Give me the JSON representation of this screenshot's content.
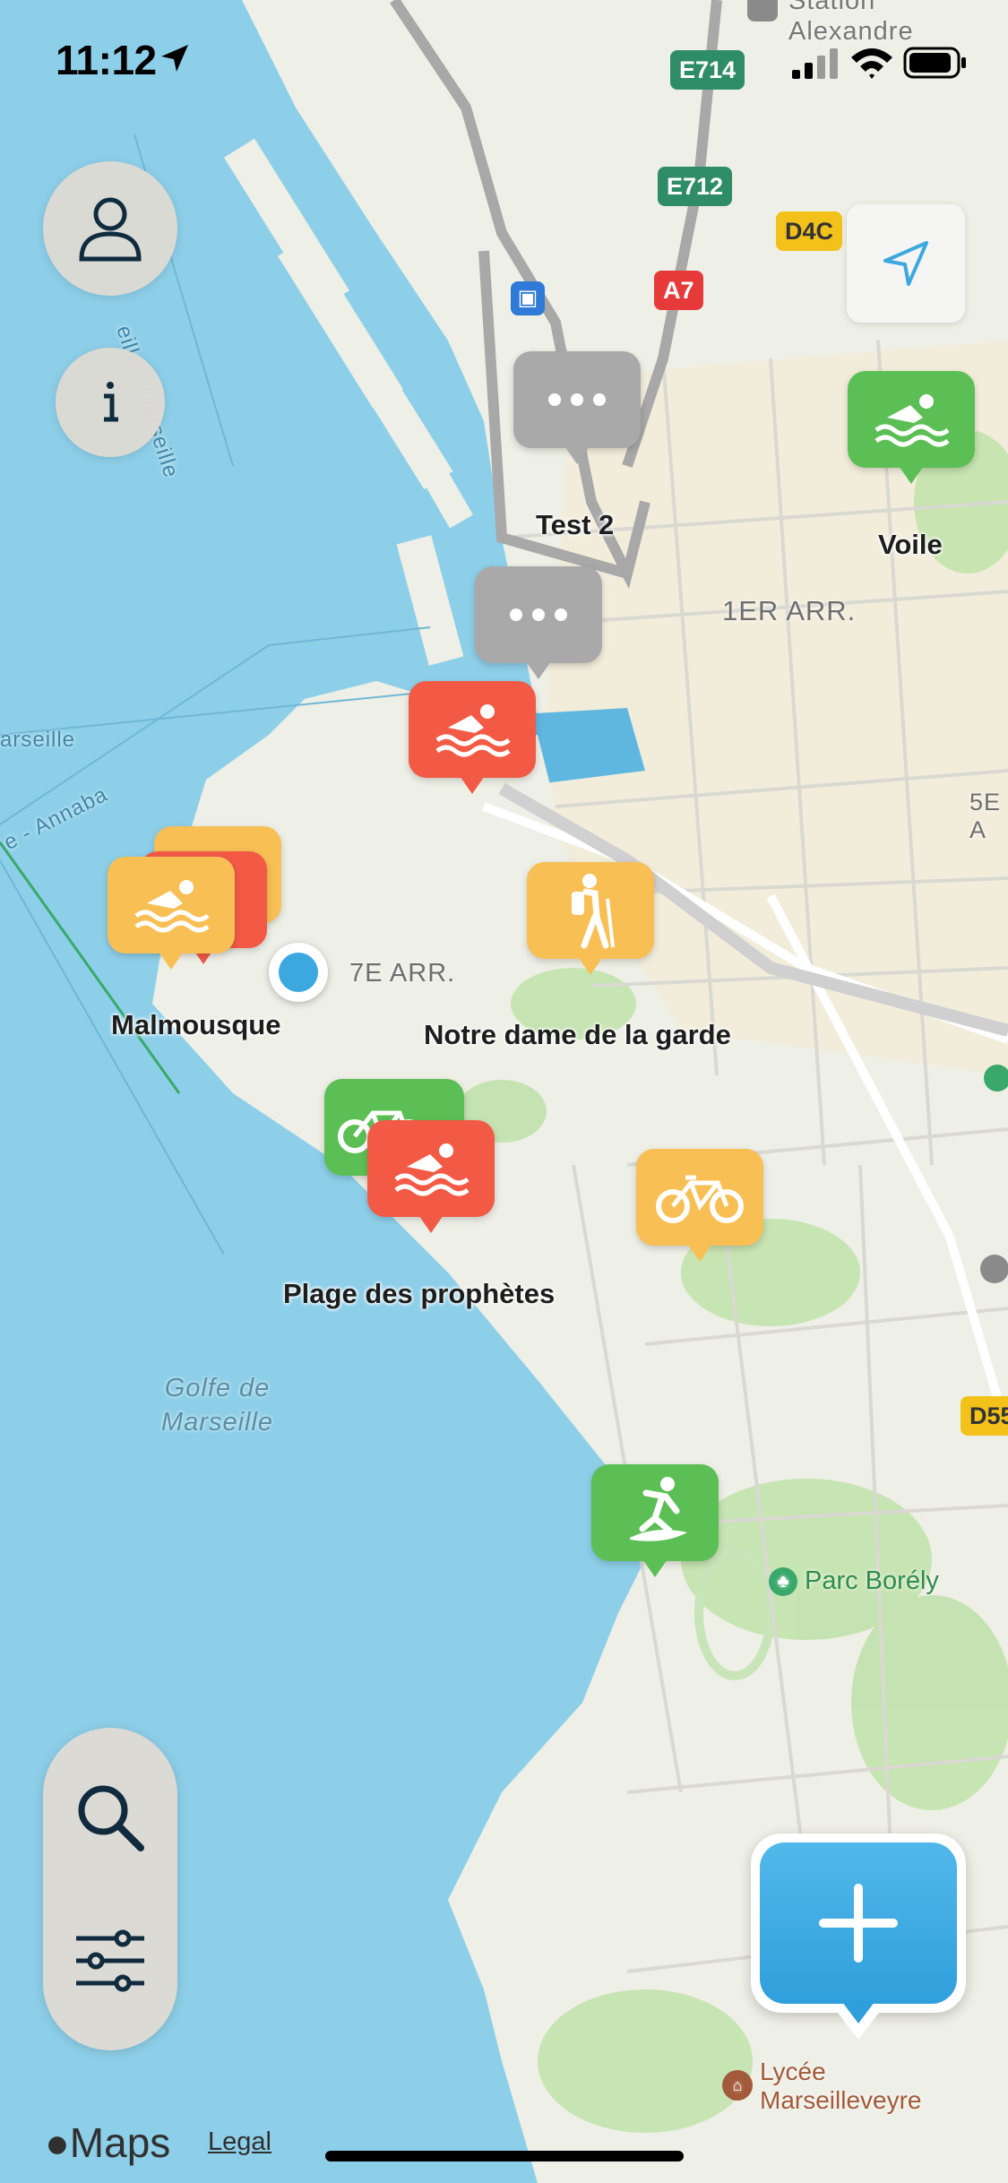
{
  "status_bar": {
    "time": "11:12"
  },
  "map": {
    "labels": {
      "district_1": "1ER ARR.",
      "district_7": "7E ARR.",
      "district_5": "5E A",
      "gulf": "Golfe de\nMarseille",
      "station": "Station\nAlexandre",
      "park": "Parc Borély",
      "lycee": "Lycée\nMarseilleveyre",
      "ferry_1": "eille - Marseille",
      "ferry_2": "arseille",
      "ferry_3": "e - Annaba"
    },
    "road_shields": [
      {
        "label": "E714",
        "color": "#2e8c67"
      },
      {
        "label": "E712",
        "color": "#2e8c67"
      },
      {
        "label": "A7",
        "color": "#e63a3a"
      },
      {
        "label": "D4C",
        "color": "#f2c21b"
      },
      {
        "label": "D55",
        "color": "#f2c21b"
      }
    ],
    "pins": [
      {
        "name": "Test 2",
        "category": "chat",
        "color": "#a9a9a9",
        "icon": "ellipsis-icon"
      },
      {
        "name": "",
        "category": "chat",
        "color": "#a9a9a9",
        "icon": "ellipsis-icon"
      },
      {
        "name": "Voile",
        "category": "swimming",
        "color": "#5cbf55",
        "icon": "swimmer-icon"
      },
      {
        "name": "",
        "category": "swimming",
        "color": "#f25a46",
        "icon": "swimmer-icon"
      },
      {
        "name": "Malmousque",
        "category": "swimming",
        "color": "#f8bf55",
        "icon": "swimmer-icon"
      },
      {
        "name": "Notre dame de la garde",
        "category": "hiking",
        "color": "#f8bf55",
        "icon": "hiker-icon"
      },
      {
        "name": "Plage des prophètes",
        "category": "swimming",
        "color": "#f25a46",
        "icon": "swimmer-icon"
      },
      {
        "name": "",
        "category": "cycling",
        "color": "#5cbf55",
        "icon": "bicycle-icon"
      },
      {
        "name": "",
        "category": "cycling",
        "color": "#f8bf55",
        "icon": "bicycle-icon"
      },
      {
        "name": "",
        "category": "surfing",
        "color": "#5cbf55",
        "icon": "surfer-icon"
      }
    ]
  },
  "controls": {
    "profile": "person-icon",
    "info": "info-icon",
    "locate": "location-arrow-icon",
    "search": "search-icon",
    "filters": "sliders-icon",
    "add": "plus-icon"
  },
  "footer": {
    "maps_brand": "Maps",
    "legal": "Legal"
  },
  "colors": {
    "water": "#8dcfe8",
    "land": "#eeefe6",
    "accent_blue": "#3ba8e0"
  }
}
